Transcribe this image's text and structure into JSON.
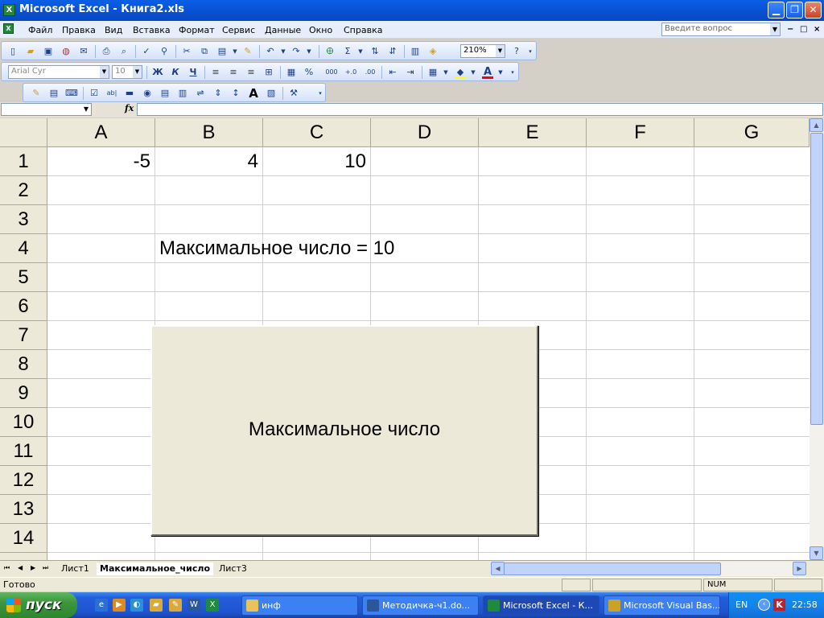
{
  "window": {
    "title": "Microsoft Excel - Книга2.xls",
    "app_icon": "excel-icon",
    "controls": [
      "minimize-icon",
      "restore-icon",
      "close-icon"
    ]
  },
  "menu": {
    "items": [
      "Файл",
      "Правка",
      "Вид",
      "Вставка",
      "Формат",
      "Сервис",
      "Данные",
      "Окно",
      "Справка"
    ],
    "underline": [
      "Ф",
      "П",
      "В",
      "а",
      "Ф",
      "С",
      "Д",
      "О",
      "С"
    ],
    "ask_placeholder": "Введите вопрос",
    "doc_controls": [
      "−",
      "□",
      "×"
    ]
  },
  "toolbar_standard": {
    "zoom": "210%",
    "sum_symbol": "Σ"
  },
  "toolbar_formatting": {
    "font": "Arial Cyr",
    "size": "10",
    "bold": "Ж",
    "italic": "К",
    "underline": "Ч",
    "percent": "%",
    "thousands": "000",
    "font_color_letter": "A",
    "font_color": "#ff0000",
    "fill_color": "#ffff00"
  },
  "toolbar_forms": {
    "label_A": "A"
  },
  "formula_bar": {
    "name_box": "",
    "fx": "fx",
    "formula": ""
  },
  "grid": {
    "columns": [
      "A",
      "B",
      "C",
      "D",
      "E",
      "F",
      "G"
    ],
    "rows": [
      "1",
      "2",
      "3",
      "4",
      "5",
      "6",
      "7",
      "8",
      "9",
      "10",
      "11",
      "12",
      "13",
      "14"
    ],
    "cells": {
      "A1": "-5",
      "B1": "4",
      "C1": "10",
      "B4": "Максимальное число = 10"
    }
  },
  "macro_button": {
    "label": "Максимальное число"
  },
  "sheet_tabs": {
    "tabs": [
      "Лист1",
      "Максимальное_число",
      "Лист3"
    ],
    "active": "Максимальное_число"
  },
  "status_bar": {
    "status": "Готово",
    "num": "NUM"
  },
  "taskbar": {
    "start": "пуск",
    "tasks": [
      {
        "label": "инф",
        "icon": "folder-icon"
      },
      {
        "label": "Методичка-ч1.do...",
        "icon": "word-icon"
      },
      {
        "label": "Microsoft Excel - К...",
        "icon": "excel-icon"
      },
      {
        "label": "Microsoft Visual Bas...",
        "icon": "vba-icon"
      }
    ],
    "lang": "EN",
    "clock": "22:58"
  }
}
